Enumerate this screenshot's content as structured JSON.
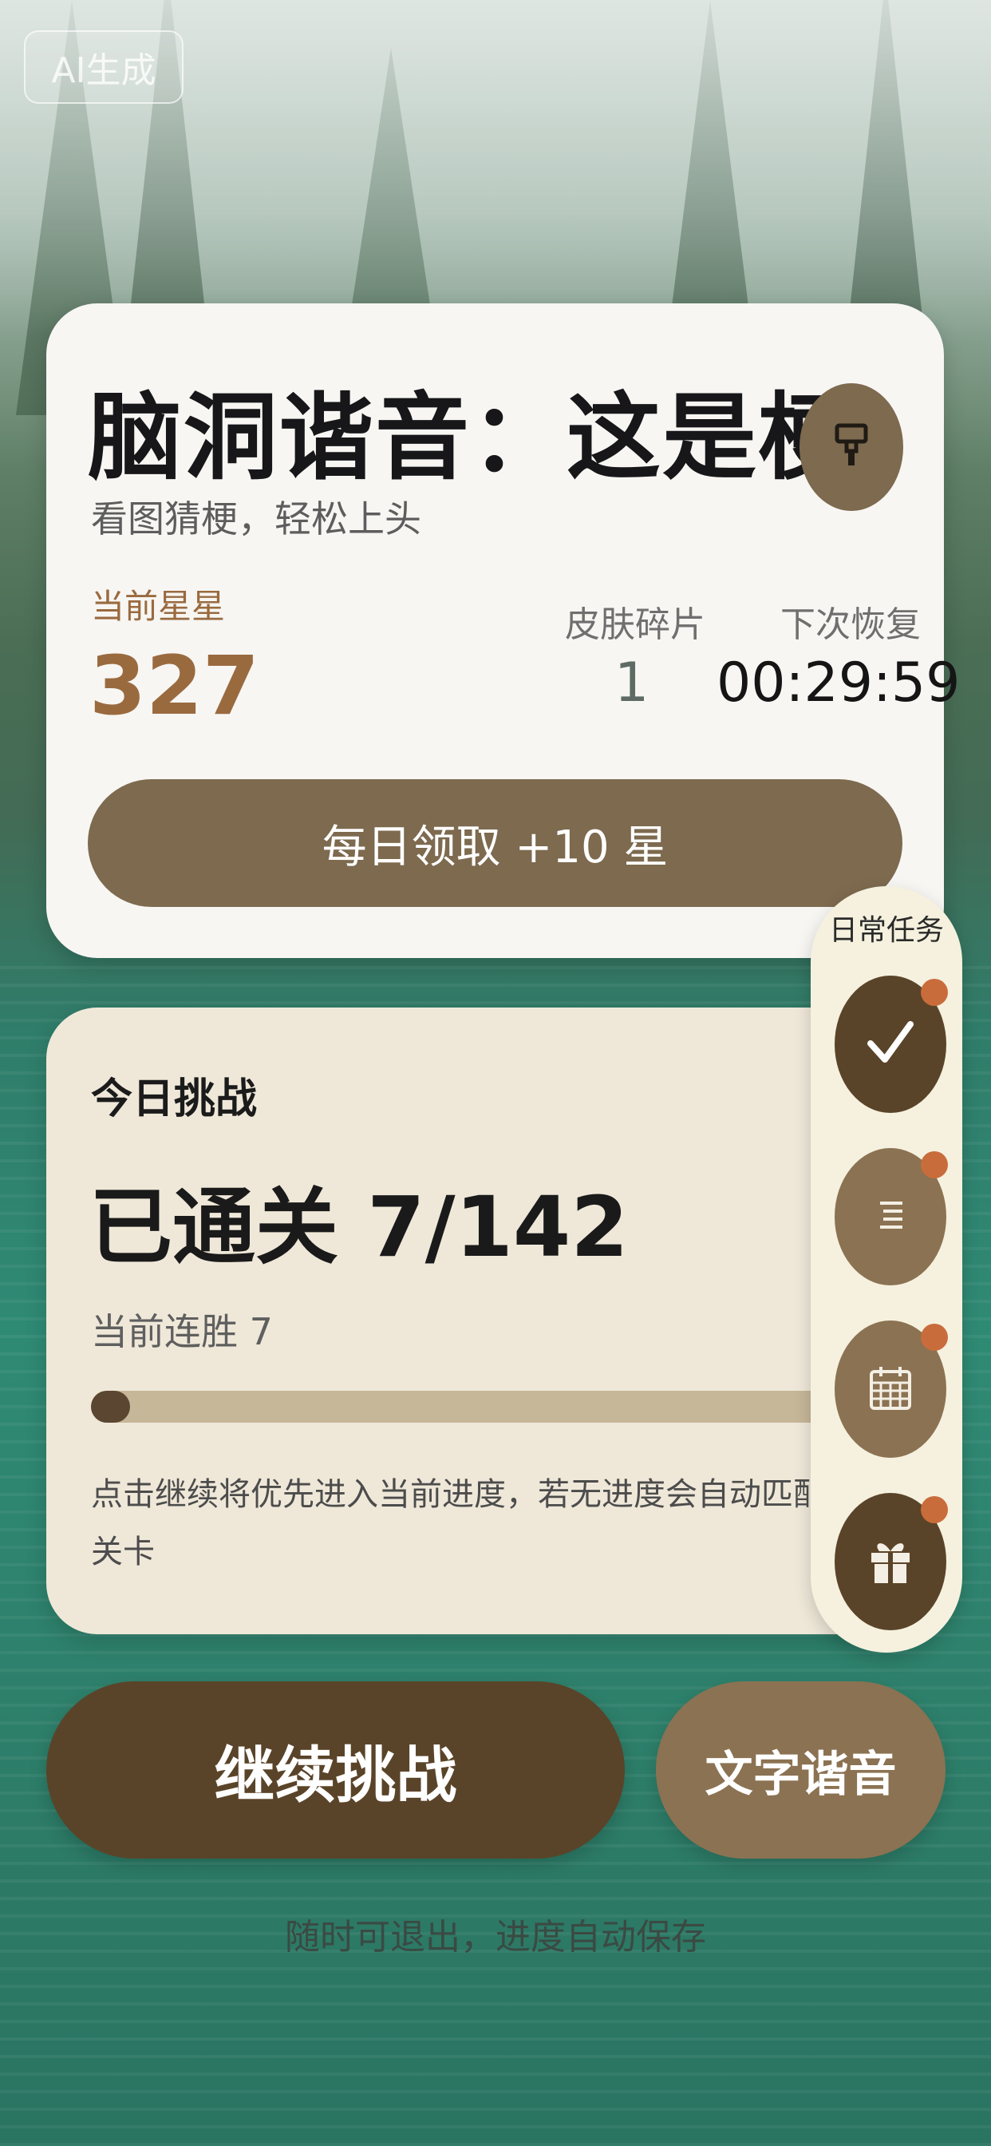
{
  "badge": {
    "text": "AI生成"
  },
  "header_card": {
    "title": "脑洞谐音：这是梗",
    "subtitle": "看图猜梗，轻松上头",
    "stars": {
      "label": "当前星星",
      "value": "327"
    },
    "fragments": {
      "label": "皮肤碎片",
      "value": "1"
    },
    "recovery": {
      "label": "下次恢复",
      "value": "00:29:59"
    },
    "daily_button_label": "每日领取 +10 星",
    "icons": {
      "theme": "paint-brush-icon"
    }
  },
  "challenge_card": {
    "heading": "今日挑战",
    "cleared_text": "已通关 7/142",
    "streak_text": "当前连胜 7",
    "progress": {
      "current": 7,
      "total": 142
    },
    "hint": "点击继续将优先进入当前进度，若无进度会自动匹配未关卡"
  },
  "daily_tasks": {
    "title": "日常任务",
    "items": [
      {
        "icon": "checkmark-icon",
        "has_badge": true
      },
      {
        "icon": "list-icon",
        "has_badge": true
      },
      {
        "icon": "calendar-icon",
        "has_badge": true
      },
      {
        "icon": "gift-icon",
        "has_badge": true
      }
    ]
  },
  "actions": {
    "continue_label": "继续挑战",
    "text_pun_label": "文字谐音"
  },
  "footer": {
    "note": "随时可退出，进度自动保存"
  },
  "colors": {
    "primary_brown": "#7d6a4f",
    "dark_brown": "#5a4429",
    "star_accent": "#9a6a3f",
    "badge_dot": "#c96c3b"
  }
}
